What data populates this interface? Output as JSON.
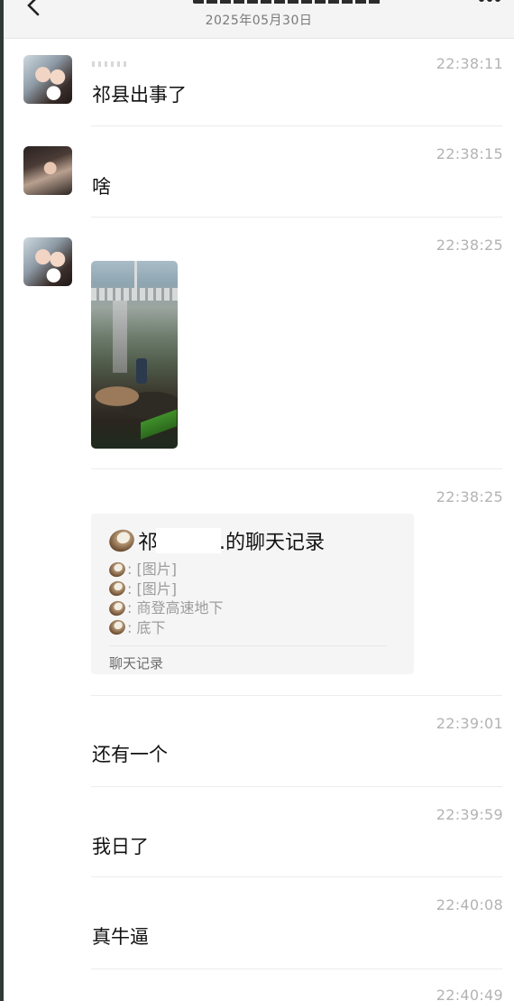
{
  "header": {
    "date": "2025年05月30日"
  },
  "messages": [
    {
      "time": "22:38:11",
      "text": "祁县出事了"
    },
    {
      "time": "22:38:15",
      "text": "啥"
    },
    {
      "time": "22:38:25"
    },
    {
      "time": "22:38:25",
      "card": {
        "title_left": "祁",
        "title_right": ".的聊天记录",
        "lines": [
          ": [图片]",
          ": [图片]",
          ": 商登高速地下",
          ": 底下"
        ],
        "footer": "聊天记录"
      }
    },
    {
      "time": "22:39:01",
      "text": "还有一个"
    },
    {
      "time": "22:39:59",
      "text": "我日了"
    },
    {
      "time": "22:40:08",
      "text": "真牛逼"
    },
    {
      "time": "22:40:49"
    }
  ]
}
